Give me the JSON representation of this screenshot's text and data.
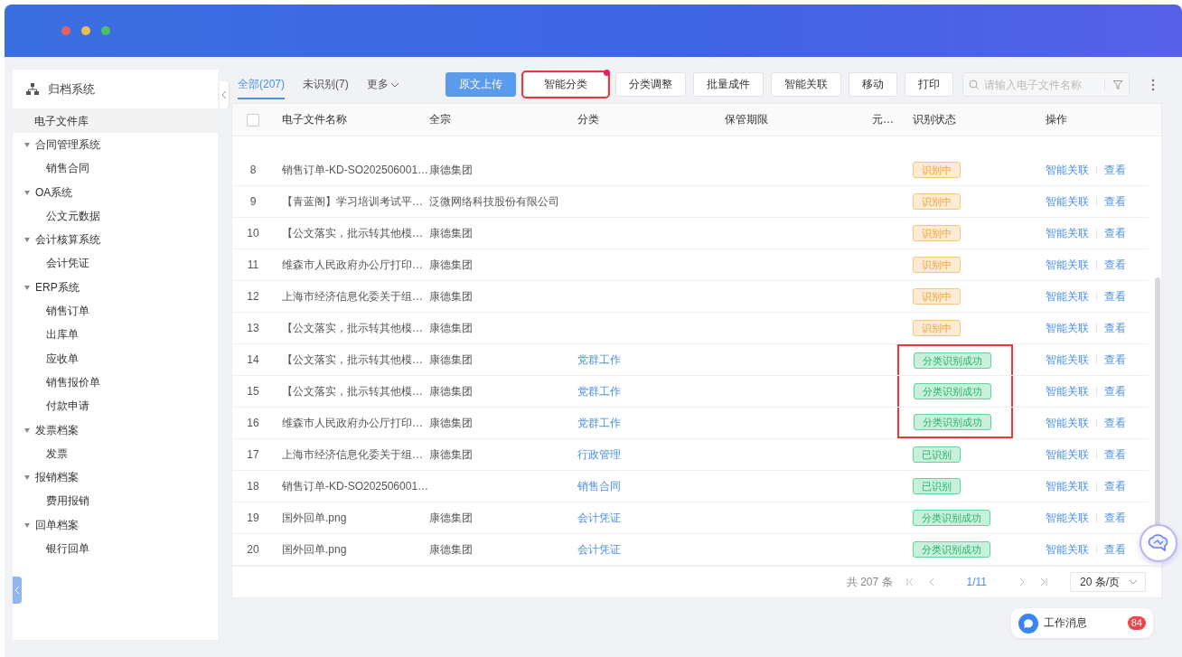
{
  "sidebar": {
    "title": "归档系统",
    "items": [
      {
        "label": "电子文件库",
        "selected": true
      },
      {
        "label": "合同管理系统",
        "selected": false,
        "expanded": true,
        "children": [
          {
            "label": "销售合同",
            "selected": false
          }
        ]
      },
      {
        "label": "OA系统",
        "selected": false,
        "expanded": true,
        "children": [
          {
            "label": "公文元数据",
            "selected": false
          }
        ]
      },
      {
        "label": "会计核算系统",
        "selected": false,
        "expanded": true,
        "children": [
          {
            "label": "会计凭证",
            "selected": false
          }
        ]
      },
      {
        "label": "ERP系统",
        "selected": false,
        "expanded": true,
        "children": [
          {
            "label": "销售订单",
            "selected": false
          },
          {
            "label": "出库单",
            "selected": false
          },
          {
            "label": "应收单",
            "selected": false
          },
          {
            "label": "销售报价单",
            "selected": false
          },
          {
            "label": "付款申请",
            "selected": false
          }
        ]
      },
      {
        "label": "发票档案",
        "selected": false,
        "expanded": true,
        "children": [
          {
            "label": "发票",
            "selected": false
          }
        ]
      },
      {
        "label": "报销档案",
        "selected": false,
        "expanded": true,
        "children": [
          {
            "label": "费用报销",
            "selected": false
          }
        ]
      },
      {
        "label": "回单档案",
        "selected": false,
        "expanded": true,
        "children": [
          {
            "label": "银行回单",
            "selected": false
          }
        ]
      }
    ]
  },
  "tabs": [
    {
      "label": "全部(207)",
      "selected": true
    },
    {
      "label": "未识别(7)",
      "selected": false
    }
  ],
  "more_menu": {
    "label": "更多"
  },
  "buttons": [
    {
      "label": "原文上传",
      "kind": "primary",
      "highlighted": false,
      "dot": false
    },
    {
      "label": "智能分类",
      "kind": "default",
      "highlighted": true,
      "dot": true
    },
    {
      "label": "分类调整",
      "kind": "default",
      "highlighted": false,
      "dot": false
    },
    {
      "label": "批量成件",
      "kind": "default",
      "highlighted": false,
      "dot": false
    },
    {
      "label": "智能关联",
      "kind": "default",
      "highlighted": false,
      "dot": false
    },
    {
      "label": "移动",
      "kind": "default",
      "highlighted": false,
      "dot": false
    },
    {
      "label": "打印",
      "kind": "default",
      "highlighted": false,
      "dot": false
    }
  ],
  "search": {
    "placeholder": "请输入电子文件名称"
  },
  "table": {
    "columns": [
      "电子文件名称",
      "全宗",
      "分类",
      "保管期限",
      "元…",
      "识别状态",
      "操作"
    ],
    "all_checked": false,
    "rows": [
      {
        "no": "8",
        "name": "销售订单-KD-SO202506001…",
        "fonds": "康德集团",
        "status": {
          "label": "识别中",
          "kind": "recognizing"
        },
        "highlighted": false,
        "actions": [
          "智能关联",
          "查看"
        ]
      },
      {
        "no": "9",
        "name": "【青蓝阁】学习培训考试平…",
        "fonds": "泛微网络科技股份有限公司",
        "status": {
          "label": "识别中",
          "kind": "recognizing"
        },
        "highlighted": false,
        "actions": [
          "智能关联",
          "查看"
        ]
      },
      {
        "no": "10",
        "name": "【公文落实，批示转其他模…",
        "fonds": "康德集团",
        "status": {
          "label": "识别中",
          "kind": "recognizing"
        },
        "highlighted": false,
        "actions": [
          "智能关联",
          "查看"
        ]
      },
      {
        "no": "11",
        "name": "维森市人民政府办公厅打印…",
        "fonds": "康德集团",
        "status": {
          "label": "识别中",
          "kind": "recognizing"
        },
        "highlighted": false,
        "actions": [
          "智能关联",
          "查看"
        ]
      },
      {
        "no": "12",
        "name": "上海市经济信息化委关于组…",
        "fonds": "康德集团",
        "status": {
          "label": "识别中",
          "kind": "recognizing"
        },
        "highlighted": false,
        "actions": [
          "智能关联",
          "查看"
        ]
      },
      {
        "no": "13",
        "name": "【公文落实，批示转其他模…",
        "fonds": "康德集团",
        "status": {
          "label": "识别中",
          "kind": "recognizing"
        },
        "highlighted": false,
        "actions": [
          "智能关联",
          "查看"
        ]
      },
      {
        "no": "14",
        "name": "【公文落实，批示转其他模…",
        "fonds": "康德集团",
        "category": "党群工作",
        "status": {
          "label": "分类识别成功",
          "kind": "classified"
        },
        "highlighted": true,
        "actions": [
          "智能关联",
          "查看"
        ]
      },
      {
        "no": "15",
        "name": "【公文落实，批示转其他模…",
        "fonds": "康德集团",
        "category": "党群工作",
        "status": {
          "label": "分类识别成功",
          "kind": "classified"
        },
        "highlighted": true,
        "actions": [
          "智能关联",
          "查看"
        ]
      },
      {
        "no": "16",
        "name": "维森市人民政府办公厅打印…",
        "fonds": "康德集团",
        "category": "党群工作",
        "status": {
          "label": "分类识别成功",
          "kind": "classified"
        },
        "highlighted": true,
        "actions": [
          "智能关联",
          "查看"
        ]
      },
      {
        "no": "17",
        "name": "上海市经济信息化委关于组…",
        "fonds": "康德集团",
        "category": "行政管理",
        "status": {
          "label": "已识别",
          "kind": "recognized"
        },
        "highlighted": false,
        "actions": [
          "智能关联",
          "查看"
        ]
      },
      {
        "no": "18",
        "name": "销售订单-KD-SO202506001…",
        "category": "销售合同",
        "status": {
          "label": "已识别",
          "kind": "recognized"
        },
        "highlighted": false,
        "actions": [
          "智能关联",
          "查看"
        ]
      },
      {
        "no": "19",
        "name": "国外回单.png",
        "fonds": "康德集团",
        "category": "会计凭证",
        "status": {
          "label": "分类识别成功",
          "kind": "classified"
        },
        "highlighted": false,
        "actions": [
          "智能关联",
          "查看"
        ]
      },
      {
        "no": "20",
        "name": "国外回单.png",
        "fonds": "康德集团",
        "category": "会计凭证",
        "status": {
          "label": "分类识别成功",
          "kind": "classified"
        },
        "highlighted": false,
        "actions": [
          "智能关联",
          "查看"
        ]
      }
    ]
  },
  "pagination": {
    "total": "共 207 条",
    "page": "1/11",
    "page_size": "20 条/页"
  },
  "messages": {
    "label": "工作消息",
    "count": "84"
  }
}
